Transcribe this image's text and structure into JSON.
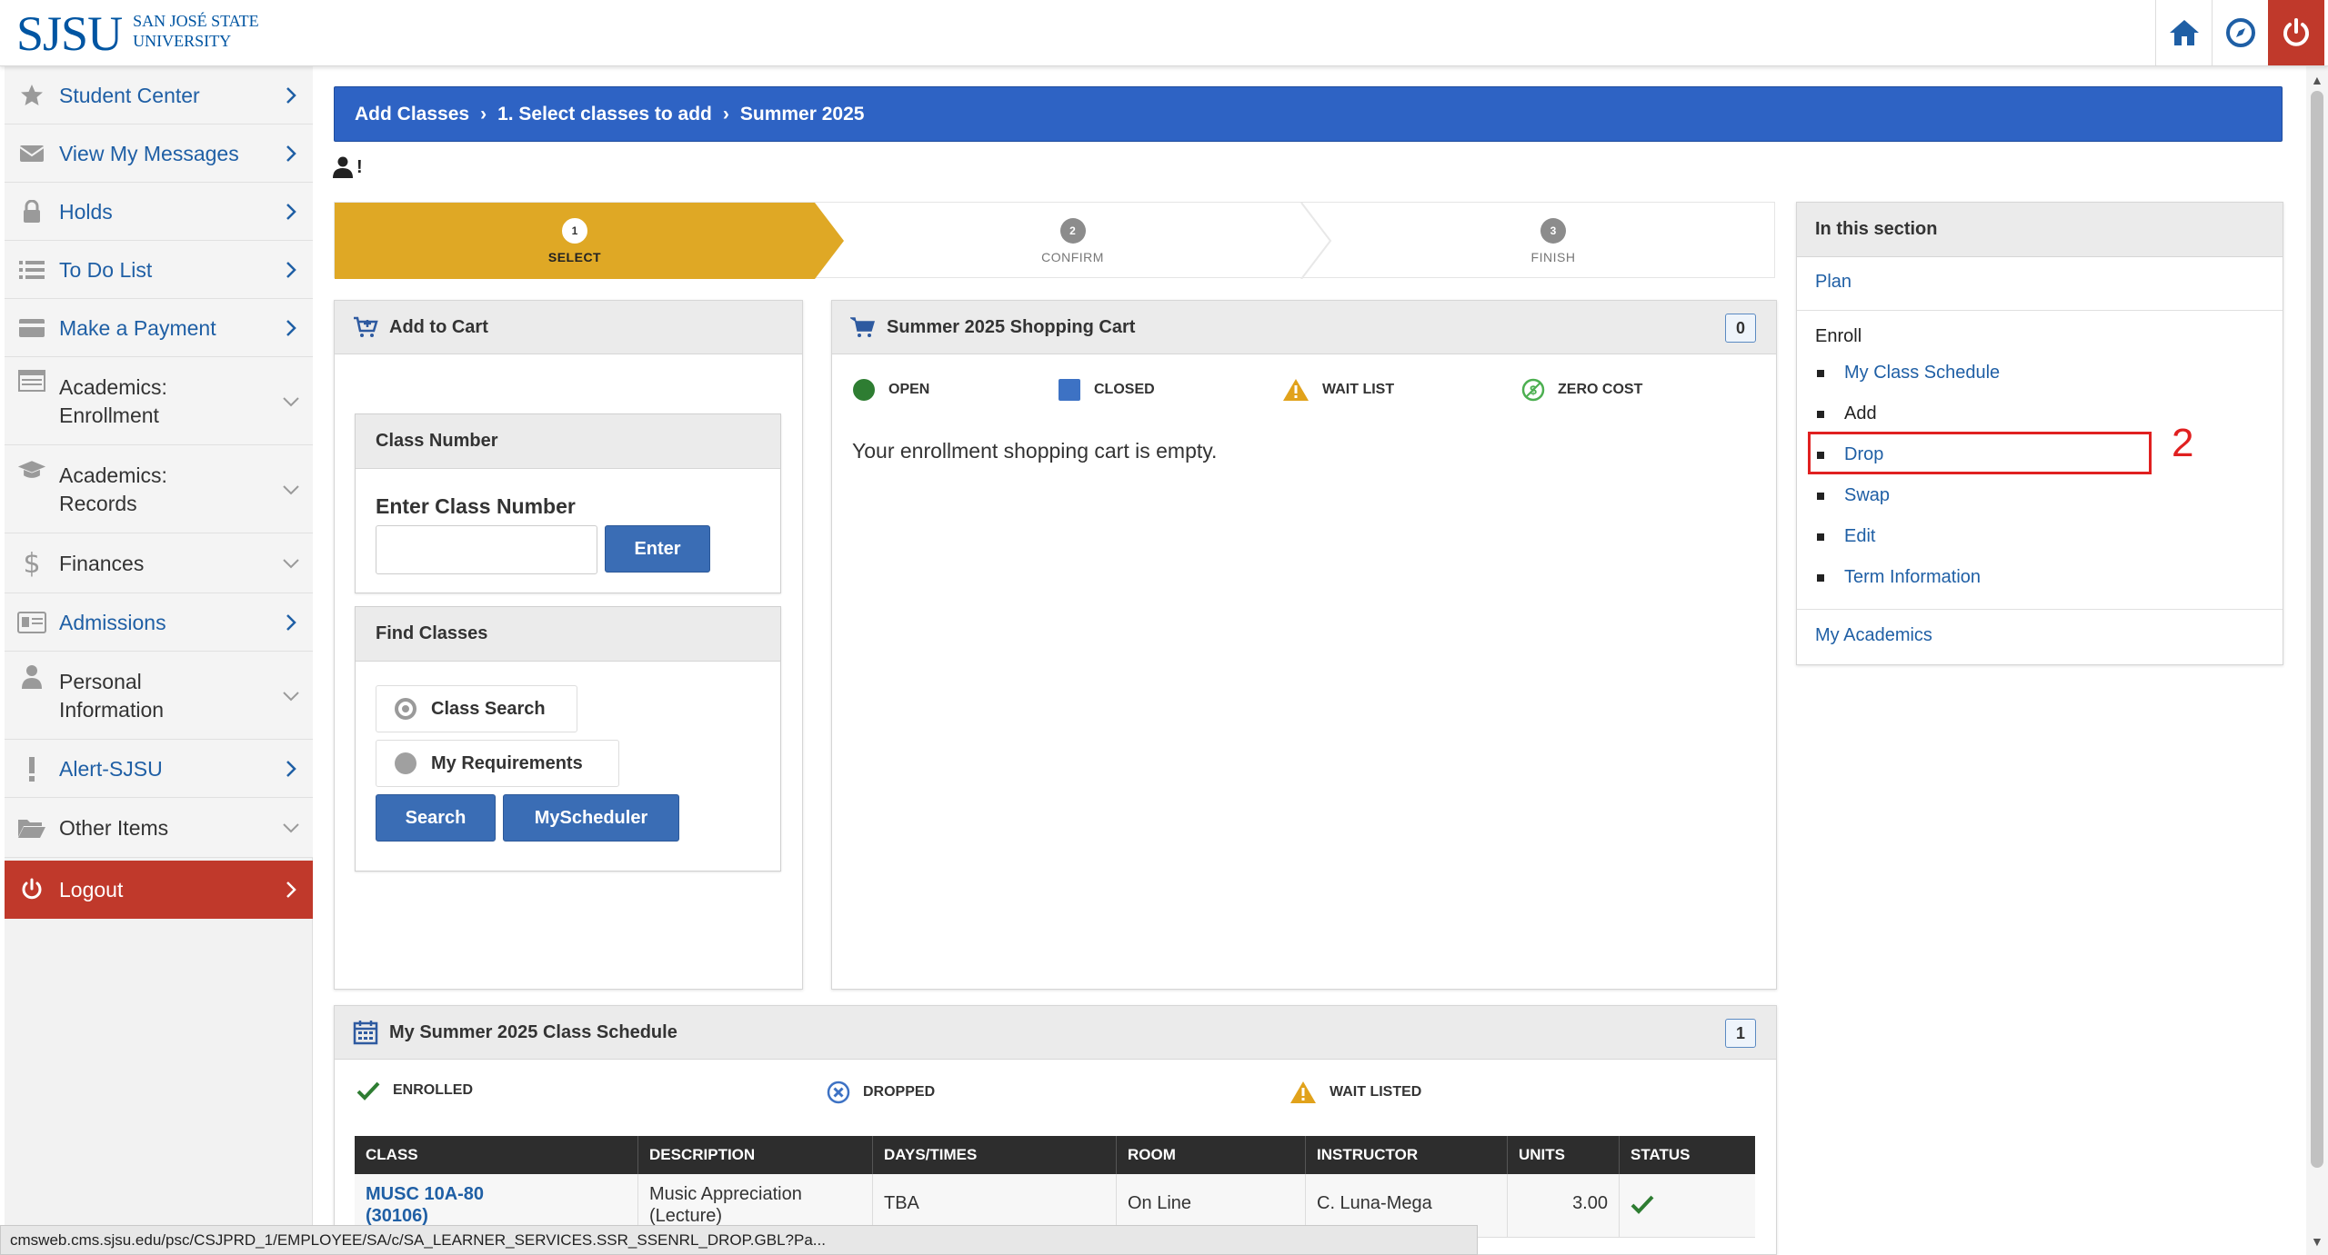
{
  "header": {
    "logo_mark": "SJSU",
    "logo_line1": "SAN JOSÉ STATE",
    "logo_line2": "UNIVERSITY",
    "icons": [
      "home-icon",
      "compass-icon",
      "power-icon"
    ]
  },
  "sidebar": {
    "items": [
      {
        "label": "Student Center",
        "icon": "star-icon",
        "chevron": "right"
      },
      {
        "label": "View My Messages",
        "icon": "envelope-icon",
        "chevron": "right"
      },
      {
        "label": "Holds",
        "icon": "lock-icon",
        "chevron": "right"
      },
      {
        "label": "To Do List",
        "icon": "list-icon",
        "chevron": "right"
      },
      {
        "label": "Make a Payment",
        "icon": "credit-card-icon",
        "chevron": "right"
      },
      {
        "label_line1": "Academics:",
        "label_line2": "Enrollment",
        "icon": "table-icon",
        "chevron": "down"
      },
      {
        "label_line1": "Academics:",
        "label_line2": "Records",
        "icon": "graduation-cap-icon",
        "chevron": "down"
      },
      {
        "label": "Finances",
        "icon": "dollar-icon",
        "chevron": "down"
      },
      {
        "label": "Admissions",
        "icon": "id-card-icon",
        "chevron": "right"
      },
      {
        "label_line1": "Personal",
        "label_line2": "Information",
        "icon": "user-icon",
        "chevron": "down"
      },
      {
        "label": "Alert-SJSU",
        "icon": "exclamation-icon",
        "chevron": "right"
      },
      {
        "label": "Other Items",
        "icon": "folder-open-icon",
        "chevron": "down"
      },
      {
        "label": "Logout",
        "icon": "power-icon",
        "chevron": "right"
      }
    ]
  },
  "breadcrumb": {
    "items": [
      "Add Classes",
      "1.  Select classes to add",
      "Summer 2025"
    ]
  },
  "person": {
    "suffix": "!"
  },
  "steps": [
    {
      "num": "1",
      "label": "SELECT",
      "state": "active"
    },
    {
      "num": "2",
      "label": "CONFIRM",
      "state": "inactive"
    },
    {
      "num": "3",
      "label": "FINISH",
      "state": "inactive"
    }
  ],
  "add_to_cart": {
    "title": "Add to Cart",
    "class_number": {
      "header": "Class Number",
      "prompt": "Enter Class Number",
      "input_value": "",
      "enter_label": "Enter"
    },
    "find_classes": {
      "header": "Find Classes",
      "options": [
        "Class Search",
        "My Requirements"
      ],
      "selected": "Class Search",
      "search_label": "Search",
      "myscheduler_label": "MyScheduler"
    }
  },
  "cart": {
    "title": "Summer 2025 Shopping Cart",
    "count": "0",
    "legend": [
      {
        "label": "OPEN",
        "icon": "green-circle-icon",
        "color": "#2e7d32"
      },
      {
        "label": "CLOSED",
        "icon": "blue-square-icon",
        "color": "#3d72c4"
      },
      {
        "label": "WAIT LIST",
        "icon": "warning-triangle-icon",
        "color": "#e1a21b"
      },
      {
        "label": "ZERO COST",
        "icon": "zero-cost-icon",
        "color": "#4caf50"
      }
    ],
    "empty_message": "Your enrollment shopping cart is empty."
  },
  "section_menu": {
    "title": "In this section",
    "plan": "Plan",
    "enroll_heading": "Enroll",
    "enroll_items": [
      "My Class Schedule",
      "Add",
      "Drop",
      "Swap",
      "Edit",
      "Term Information"
    ],
    "my_academics": "My Academics",
    "annotation_number": "2"
  },
  "schedule": {
    "title": "My Summer 2025 Class Schedule",
    "count": "1",
    "legend": [
      {
        "label": "ENROLLED",
        "icon": "checkmark-icon"
      },
      {
        "label": "DROPPED",
        "icon": "dropped-circle-icon"
      },
      {
        "label": "WAIT LISTED",
        "icon": "warning-triangle-icon"
      }
    ],
    "columns": [
      "CLASS",
      "DESCRIPTION",
      "DAYS/TIMES",
      "ROOM",
      "INSTRUCTOR",
      "UNITS",
      "STATUS"
    ],
    "rows": [
      {
        "class_line1": "MUSC 10A-80",
        "class_line2": "(30106)",
        "description_line1": "Music Appreciation",
        "description_line2": "(Lecture)",
        "days_times": "TBA",
        "room": "On Line",
        "instructor": "C. Luna-Mega",
        "units": "3.00",
        "status": "enrolled"
      }
    ]
  },
  "status_bar": {
    "url": "cmsweb.cms.sjsu.edu/psc/CSJPRD_1/EMPLOYEE/SA/c/SA_LEARNER_SERVICES.SSR_SSENRL_DROP.GBL?Pa..."
  },
  "colors": {
    "brand_blue": "#0055a2",
    "breadcrumb_blue": "#2e63c4",
    "button_blue": "#3a6db5",
    "active_step": "#dfa825",
    "logout_red": "#c0392b",
    "annotation_red": "#e02020"
  }
}
